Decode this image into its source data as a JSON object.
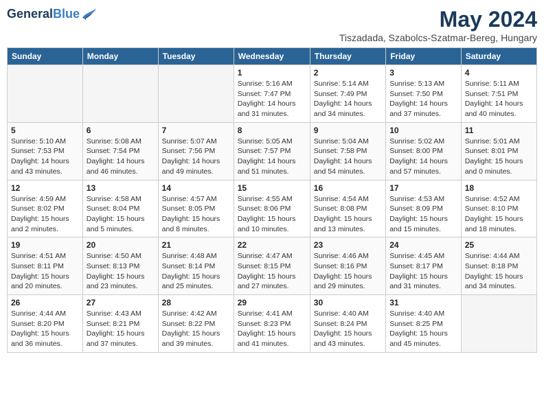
{
  "header": {
    "logo": {
      "general": "General",
      "blue": "Blue",
      "tagline": ""
    },
    "title": "May 2024",
    "subtitle": "Tiszadada, Szabolcs-Szatmar-Bereg, Hungary"
  },
  "weekdays": [
    "Sunday",
    "Monday",
    "Tuesday",
    "Wednesday",
    "Thursday",
    "Friday",
    "Saturday"
  ],
  "weeks": [
    [
      {
        "day": "",
        "info": ""
      },
      {
        "day": "",
        "info": ""
      },
      {
        "day": "",
        "info": ""
      },
      {
        "day": "1",
        "info": "Sunrise: 5:16 AM\nSunset: 7:47 PM\nDaylight: 14 hours\nand 31 minutes."
      },
      {
        "day": "2",
        "info": "Sunrise: 5:14 AM\nSunset: 7:49 PM\nDaylight: 14 hours\nand 34 minutes."
      },
      {
        "day": "3",
        "info": "Sunrise: 5:13 AM\nSunset: 7:50 PM\nDaylight: 14 hours\nand 37 minutes."
      },
      {
        "day": "4",
        "info": "Sunrise: 5:11 AM\nSunset: 7:51 PM\nDaylight: 14 hours\nand 40 minutes."
      }
    ],
    [
      {
        "day": "5",
        "info": "Sunrise: 5:10 AM\nSunset: 7:53 PM\nDaylight: 14 hours\nand 43 minutes."
      },
      {
        "day": "6",
        "info": "Sunrise: 5:08 AM\nSunset: 7:54 PM\nDaylight: 14 hours\nand 46 minutes."
      },
      {
        "day": "7",
        "info": "Sunrise: 5:07 AM\nSunset: 7:56 PM\nDaylight: 14 hours\nand 49 minutes."
      },
      {
        "day": "8",
        "info": "Sunrise: 5:05 AM\nSunset: 7:57 PM\nDaylight: 14 hours\nand 51 minutes."
      },
      {
        "day": "9",
        "info": "Sunrise: 5:04 AM\nSunset: 7:58 PM\nDaylight: 14 hours\nand 54 minutes."
      },
      {
        "day": "10",
        "info": "Sunrise: 5:02 AM\nSunset: 8:00 PM\nDaylight: 14 hours\nand 57 minutes."
      },
      {
        "day": "11",
        "info": "Sunrise: 5:01 AM\nSunset: 8:01 PM\nDaylight: 15 hours\nand 0 minutes."
      }
    ],
    [
      {
        "day": "12",
        "info": "Sunrise: 4:59 AM\nSunset: 8:02 PM\nDaylight: 15 hours\nand 2 minutes."
      },
      {
        "day": "13",
        "info": "Sunrise: 4:58 AM\nSunset: 8:04 PM\nDaylight: 15 hours\nand 5 minutes."
      },
      {
        "day": "14",
        "info": "Sunrise: 4:57 AM\nSunset: 8:05 PM\nDaylight: 15 hours\nand 8 minutes."
      },
      {
        "day": "15",
        "info": "Sunrise: 4:55 AM\nSunset: 8:06 PM\nDaylight: 15 hours\nand 10 minutes."
      },
      {
        "day": "16",
        "info": "Sunrise: 4:54 AM\nSunset: 8:08 PM\nDaylight: 15 hours\nand 13 minutes."
      },
      {
        "day": "17",
        "info": "Sunrise: 4:53 AM\nSunset: 8:09 PM\nDaylight: 15 hours\nand 15 minutes."
      },
      {
        "day": "18",
        "info": "Sunrise: 4:52 AM\nSunset: 8:10 PM\nDaylight: 15 hours\nand 18 minutes."
      }
    ],
    [
      {
        "day": "19",
        "info": "Sunrise: 4:51 AM\nSunset: 8:11 PM\nDaylight: 15 hours\nand 20 minutes."
      },
      {
        "day": "20",
        "info": "Sunrise: 4:50 AM\nSunset: 8:13 PM\nDaylight: 15 hours\nand 23 minutes."
      },
      {
        "day": "21",
        "info": "Sunrise: 4:48 AM\nSunset: 8:14 PM\nDaylight: 15 hours\nand 25 minutes."
      },
      {
        "day": "22",
        "info": "Sunrise: 4:47 AM\nSunset: 8:15 PM\nDaylight: 15 hours\nand 27 minutes."
      },
      {
        "day": "23",
        "info": "Sunrise: 4:46 AM\nSunset: 8:16 PM\nDaylight: 15 hours\nand 29 minutes."
      },
      {
        "day": "24",
        "info": "Sunrise: 4:45 AM\nSunset: 8:17 PM\nDaylight: 15 hours\nand 31 minutes."
      },
      {
        "day": "25",
        "info": "Sunrise: 4:44 AM\nSunset: 8:18 PM\nDaylight: 15 hours\nand 34 minutes."
      }
    ],
    [
      {
        "day": "26",
        "info": "Sunrise: 4:44 AM\nSunset: 8:20 PM\nDaylight: 15 hours\nand 36 minutes."
      },
      {
        "day": "27",
        "info": "Sunrise: 4:43 AM\nSunset: 8:21 PM\nDaylight: 15 hours\nand 37 minutes."
      },
      {
        "day": "28",
        "info": "Sunrise: 4:42 AM\nSunset: 8:22 PM\nDaylight: 15 hours\nand 39 minutes."
      },
      {
        "day": "29",
        "info": "Sunrise: 4:41 AM\nSunset: 8:23 PM\nDaylight: 15 hours\nand 41 minutes."
      },
      {
        "day": "30",
        "info": "Sunrise: 4:40 AM\nSunset: 8:24 PM\nDaylight: 15 hours\nand 43 minutes."
      },
      {
        "day": "31",
        "info": "Sunrise: 4:40 AM\nSunset: 8:25 PM\nDaylight: 15 hours\nand 45 minutes."
      },
      {
        "day": "",
        "info": ""
      }
    ]
  ]
}
